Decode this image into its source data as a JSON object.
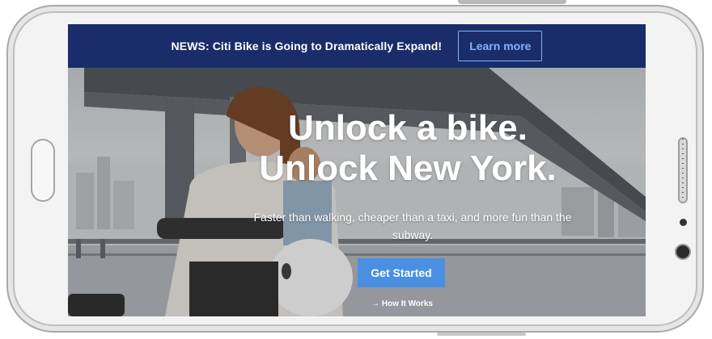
{
  "news_bar": {
    "text": "NEWS: Citi Bike is Going to Dramatically Expand!",
    "button_label": "Learn more"
  },
  "hero": {
    "headline_line1": "Unlock a bike.",
    "headline_line2": "Unlock New York.",
    "subtext": "Faster than walking, cheaper than a taxi, and more fun than the subway.",
    "cta_label": "Get Started",
    "how_arrow": "→",
    "how_label": "How It Works"
  },
  "colors": {
    "news_bar_bg": "#1a2d6a",
    "learn_more": "#7fb4ff",
    "cta_bg": "#4a8fe2"
  },
  "icons": {
    "arrow": "arrow-right-icon"
  }
}
